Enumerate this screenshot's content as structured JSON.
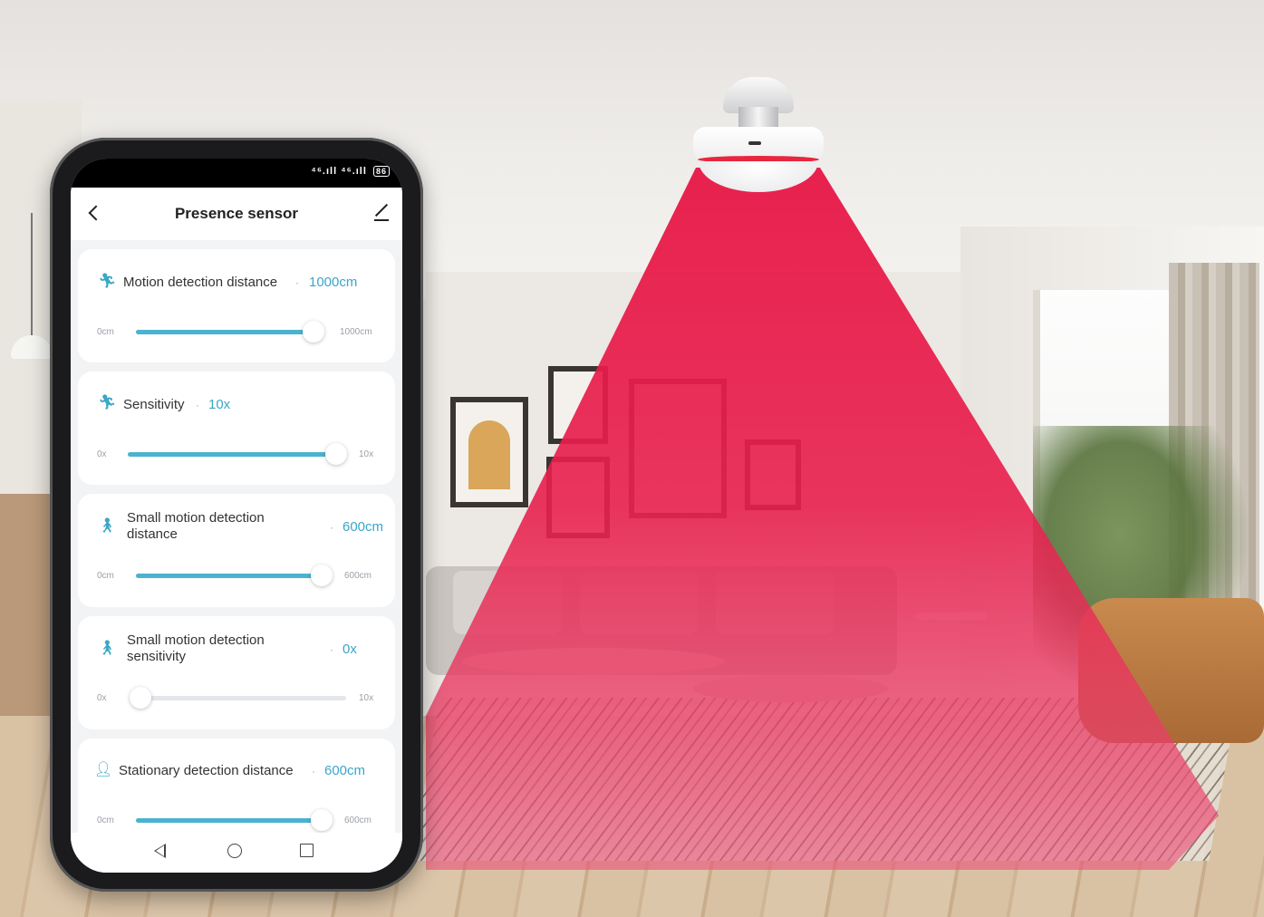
{
  "app": {
    "title": "Presence sensor"
  },
  "status": {
    "signal1": "⁴⁶.ıll",
    "signal2": "⁴⁶.ıll",
    "battery": "86"
  },
  "settings": [
    {
      "icon": "running-icon",
      "label": "Motion detection distance",
      "value": "1000cm",
      "min": "0cm",
      "max": "1000cm",
      "fraction": 1.0
    },
    {
      "icon": "running-icon",
      "label": "Sensitivity",
      "value": "10x",
      "min": "0x",
      "max": "10x",
      "fraction": 1.0
    },
    {
      "icon": "walking-icon",
      "label": "Small motion detection distance",
      "value": "600cm",
      "min": "0cm",
      "max": "600cm",
      "fraction": 1.0
    },
    {
      "icon": "walking-icon",
      "label": "Small motion detection sensitivity",
      "value": "0x",
      "min": "0x",
      "max": "10x",
      "fraction": 0.0
    },
    {
      "icon": "person-icon",
      "label": "Stationary detection distance",
      "value": "600cm",
      "min": "0cm",
      "max": "600cm",
      "fraction": 1.0
    }
  ],
  "colors": {
    "accent": "#4bb3cf",
    "beam": "#e8103f"
  }
}
